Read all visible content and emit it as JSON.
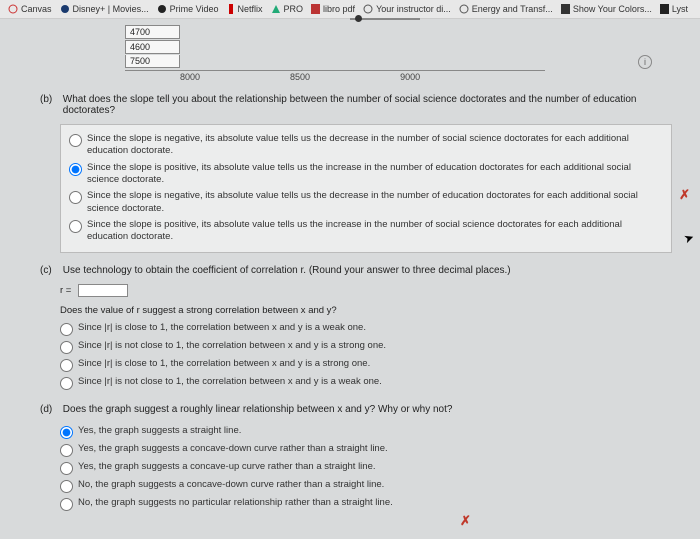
{
  "bookmarks": [
    {
      "label": "Canvas"
    },
    {
      "label": "Disney+ | Movies..."
    },
    {
      "label": "Prime Video"
    },
    {
      "label": "Netflix"
    },
    {
      "label": "PRO"
    },
    {
      "label": "libro pdf"
    },
    {
      "label": "Your instructor di..."
    },
    {
      "label": "Energy and Transf..."
    },
    {
      "label": "Show Your Colors..."
    },
    {
      "label": "Lyst"
    }
  ],
  "plot": {
    "y_vals": [
      "4700",
      "4600",
      "7500"
    ],
    "x_vals": [
      "8000",
      "8500",
      "9000"
    ]
  },
  "b": {
    "label": "(b)",
    "q": "What does the slope tell you about the relationship between the number of social science doctorates and the number of education doctorates?",
    "opts": [
      "Since the slope is negative, its absolute value tells us the decrease in the number of social science doctorates for each additional education doctorate.",
      "Since the slope is positive, its absolute value tells us the increase in the number of education doctorates for each additional social science doctorate.",
      "Since the slope is negative, its absolute value tells us the decrease in the number of education doctorates for each additional social science doctorate.",
      "Since the slope is positive, its absolute value tells us the increase in the number of social science doctorates for each additional education doctorate."
    ]
  },
  "c": {
    "label": "(c)",
    "q": "Use technology to obtain the coefficient of correlation r. (Round your answer to three decimal places.)",
    "r_prefix": "r =",
    "sub_q": "Does the value of r suggest a strong correlation between x and y?",
    "opts": [
      "Since |r| is close to 1, the correlation between x and y is a weak one.",
      "Since |r| is not close to 1, the correlation between x and y is a strong one.",
      "Since |r| is close to 1, the correlation between x and y is a strong one.",
      "Since |r| is not close to 1, the correlation between x and y is a weak one."
    ]
  },
  "d": {
    "label": "(d)",
    "q": "Does the graph suggest a roughly linear relationship between x and y? Why or why not?",
    "opts": [
      "Yes, the graph suggests a straight line.",
      "Yes, the graph suggests a concave-down curve rather than a straight line.",
      "Yes, the graph suggests a concave-up curve rather than a straight line.",
      "No, the graph suggests a concave-down curve rather than a straight line.",
      "No, the graph suggests no particular relationship rather than a straight line."
    ]
  },
  "marks": {
    "x": "✗",
    "info": "i"
  }
}
